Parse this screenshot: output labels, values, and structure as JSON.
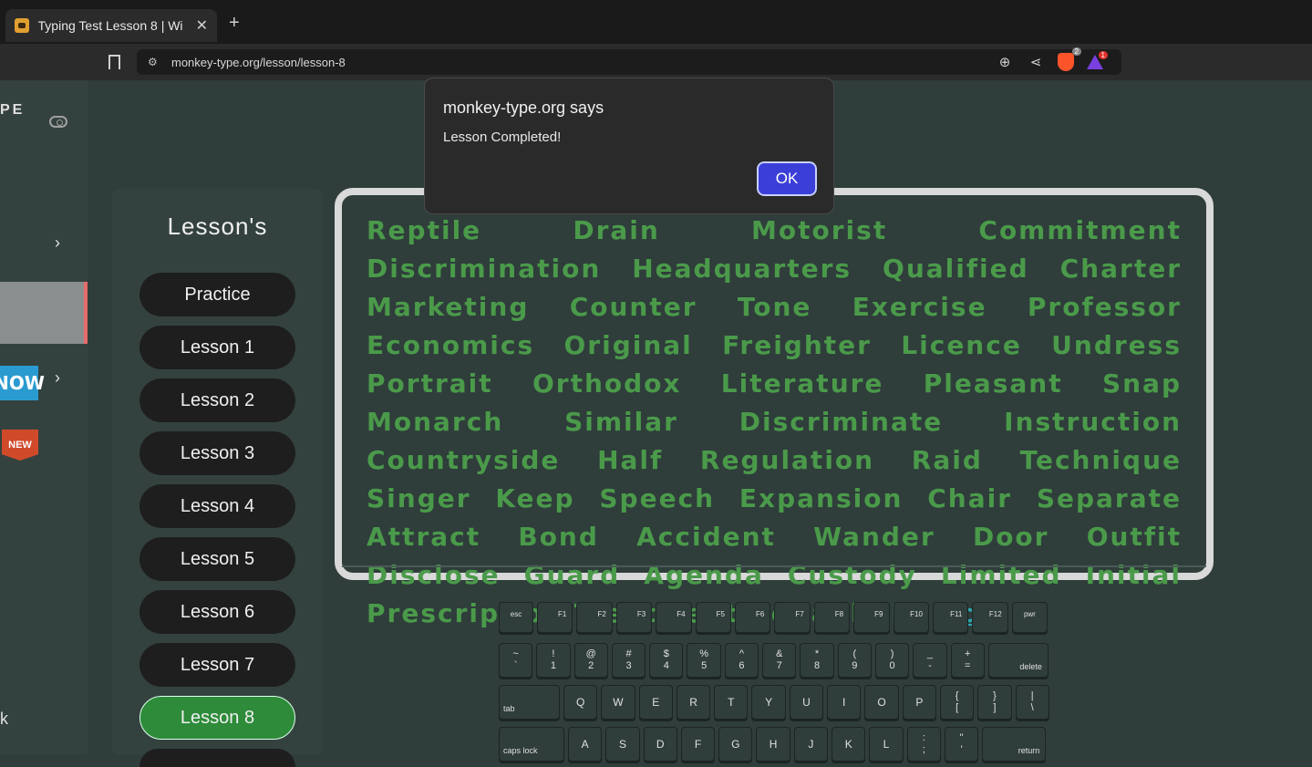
{
  "browser": {
    "tab_title": "Typing Test Lesson 8 | Wi",
    "url": "monkey-type.org/lesson/lesson-8",
    "brave_badge": "2",
    "alert_badge": "1"
  },
  "sidebar": {
    "logo": "PE",
    "now_label": "NOW",
    "new_label": "NEW",
    "bottom_text": "k"
  },
  "lessons": {
    "title": "Lesson's",
    "items": [
      "Practice",
      "Lesson 1",
      "Lesson 2",
      "Lesson 3",
      "Lesson 4",
      "Lesson 5",
      "Lesson 6",
      "Lesson 7",
      "Lesson 8"
    ],
    "active": "Lesson 8"
  },
  "typing": {
    "text": "Reptile Drain Motorist Commitment Discrimination Headquarters Qualified Charter Marketing Counter Tone Exercise Professor Economics Original Freighter Licence Undress Portrait Orthodox Literature Pleasant Snap Monarch Similar Discriminate Instruction Countryside Half Regulation Raid Technique Singer Keep Speech Expansion Chair Separate Attract Bond Accident Wander Door Outfit Disclose Guard Agenda Custody Limited Initial Prescription Treatment Reliable Basi",
    "cursor_char": "c"
  },
  "keyboard": {
    "row1": [
      "esc",
      "F1",
      "F2",
      "F3",
      "F4",
      "F5",
      "F6",
      "F7",
      "F8",
      "F9",
      "F10",
      "F11",
      "F12",
      "pwr"
    ],
    "row2": [
      [
        "~",
        "`"
      ],
      [
        "!",
        "1"
      ],
      [
        "@",
        "2"
      ],
      [
        "#",
        "3"
      ],
      [
        "$",
        "4"
      ],
      [
        "%",
        "5"
      ],
      [
        "^",
        "6"
      ],
      [
        "&",
        "7"
      ],
      [
        "*",
        "8"
      ],
      [
        "(",
        "9"
      ],
      [
        ")",
        "0"
      ],
      [
        "_",
        "-"
      ],
      [
        "+",
        "="
      ]
    ],
    "row2_end": "delete",
    "row3_start": "tab",
    "row3": [
      "Q",
      "W",
      "E",
      "R",
      "T",
      "Y",
      "U",
      "I",
      "O",
      "P"
    ],
    "row3_sym": [
      [
        "{",
        "["
      ],
      [
        "}",
        "]"
      ],
      [
        "|",
        "\\"
      ]
    ],
    "row4_start": "caps lock",
    "row4": [
      "A",
      "S",
      "D",
      "F",
      "G",
      "H",
      "J",
      "K",
      "L"
    ],
    "row4_sym": [
      [
        ":",
        ";"
      ],
      [
        "\"",
        "'"
      ]
    ],
    "row4_end": "return"
  },
  "dialog": {
    "title": "monkey-type.org says",
    "message": "Lesson Completed!",
    "ok_label": "OK"
  }
}
